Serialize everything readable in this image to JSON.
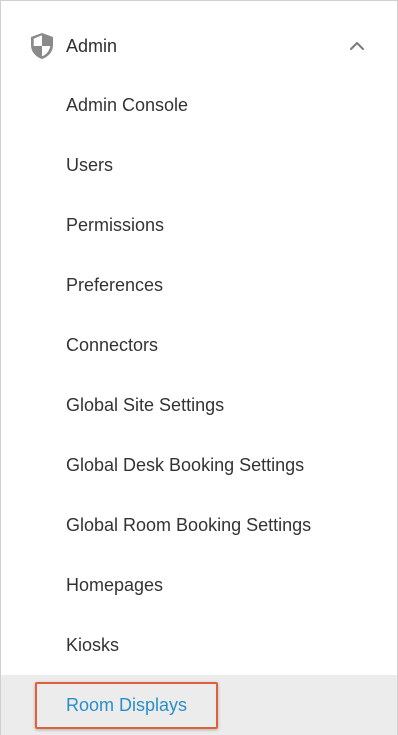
{
  "section": {
    "title": "Admin",
    "icon": "shield-icon",
    "expanded_icon": "chevron-up-icon"
  },
  "items": [
    {
      "label": "Admin Console"
    },
    {
      "label": "Users"
    },
    {
      "label": "Permissions"
    },
    {
      "label": "Preferences"
    },
    {
      "label": "Connectors"
    },
    {
      "label": "Global Site Settings"
    },
    {
      "label": "Global Desk Booking Settings"
    },
    {
      "label": "Global Room Booking Settings"
    },
    {
      "label": "Homepages"
    },
    {
      "label": "Kiosks"
    },
    {
      "label": "Room Displays",
      "active": true
    }
  ],
  "colors": {
    "active_text": "#2a8fc7",
    "active_background": "#ececec",
    "highlight_border": "#e0603c",
    "icon": "#8a8a8a"
  }
}
